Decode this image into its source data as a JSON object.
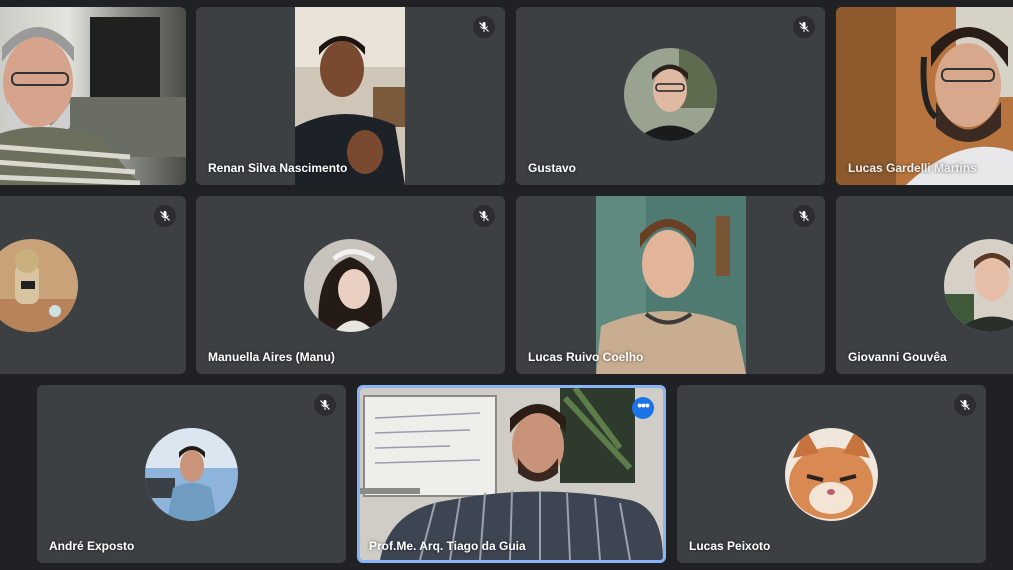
{
  "participants": [
    {
      "name": "",
      "muted": false,
      "camera": true
    },
    {
      "name": "Renan Silva Nascimento",
      "muted": true,
      "camera": true
    },
    {
      "name": "Gustavo",
      "muted": true,
      "camera": false
    },
    {
      "name": "Lucas Gardelli Martins",
      "muted": false,
      "camera": true
    },
    {
      "name": "",
      "muted": true,
      "camera": false
    },
    {
      "name": "Manuella Aires (Manu)",
      "muted": true,
      "camera": false
    },
    {
      "name": "Lucas Ruivo Coelho",
      "muted": true,
      "camera": true
    },
    {
      "name": "Giovanni Gouvêa",
      "muted": false,
      "camera": false
    },
    {
      "name": "André Exposto",
      "muted": true,
      "camera": false
    },
    {
      "name": "Prof.Me. Arq. Tiago da Guia",
      "muted": false,
      "camera": true,
      "active_speaker": true
    },
    {
      "name": "Lucas Peixoto",
      "muted": true,
      "camera": false
    }
  ],
  "colors": {
    "background": "#202124",
    "tile": "#3c4043",
    "active_border": "#8ab4f8",
    "more_button": "#1a73e8"
  },
  "icons": {
    "mute": "mic-off-icon",
    "more": "more-options-icon"
  }
}
